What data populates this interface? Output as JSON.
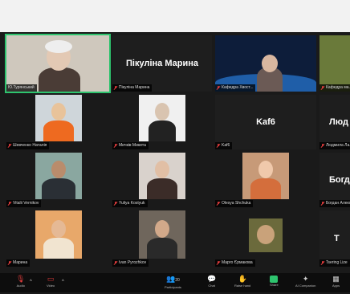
{
  "tiles": [
    {
      "id": "t0",
      "name": "Ю.Турянський",
      "kind": "video",
      "active": true,
      "muted": false
    },
    {
      "id": "t1",
      "name": "Пікуліна Марина",
      "display": "Пікуліна Марина",
      "kind": "name",
      "muted": true
    },
    {
      "id": "t2",
      "name": "Кафедра Хвост...",
      "kind": "video",
      "muted": true
    },
    {
      "id": "t3",
      "name": "Кафедра ма...",
      "kind": "video",
      "muted": true
    },
    {
      "id": "t4",
      "name": "Шевченко Наталія",
      "kind": "video",
      "muted": true
    },
    {
      "id": "t5",
      "name": "Мичків Микита",
      "kind": "video",
      "muted": true
    },
    {
      "id": "t6",
      "name": "Kaf6",
      "display": "Kaf6",
      "kind": "name",
      "muted": true
    },
    {
      "id": "t7",
      "name": "Людмила Ла...",
      "display": "Люд",
      "kind": "name",
      "muted": true
    },
    {
      "id": "t8",
      "name": "Vitalii Vernikov",
      "kind": "video",
      "muted": true
    },
    {
      "id": "t9",
      "name": "Yuliya Kostyuk",
      "kind": "video",
      "muted": true
    },
    {
      "id": "t10",
      "name": "Olesya Shchuka",
      "kind": "video",
      "muted": true
    },
    {
      "id": "t11",
      "name": "Богдан Алекс...",
      "display": "Богд",
      "kind": "name",
      "muted": true
    },
    {
      "id": "t12",
      "name": "Марина",
      "kind": "video",
      "muted": true
    },
    {
      "id": "t13",
      "name": "Ivan Pyrozhkov",
      "kind": "video",
      "muted": true
    },
    {
      "id": "t14",
      "name": "Марго Єрмакова",
      "kind": "video",
      "muted": true
    },
    {
      "id": "t15",
      "name": "Tsering Lize",
      "display": "T",
      "kind": "name",
      "muted": true
    }
  ],
  "controls": {
    "audio": {
      "label": "Audio",
      "icon": "mic-muted-icon"
    },
    "video": {
      "label": "Video",
      "icon": "camera-off-icon"
    },
    "participants": {
      "label": "Participants",
      "count": "20",
      "icon": "participants-icon"
    },
    "chat": {
      "label": "Chat",
      "icon": "chat-icon"
    },
    "raise_hand": {
      "label": "Raise hand",
      "icon": "hand-icon"
    },
    "share": {
      "label": "Share",
      "icon": "share-icon"
    },
    "ai_companion": {
      "label": "AI Companion",
      "icon": "ai-companion-icon"
    },
    "apps": {
      "label": "Apps",
      "icon": "apps-icon"
    }
  },
  "colors": {
    "active_border": "#2ec46e",
    "mute": "#e03c3c",
    "share": "#2ec46e"
  }
}
